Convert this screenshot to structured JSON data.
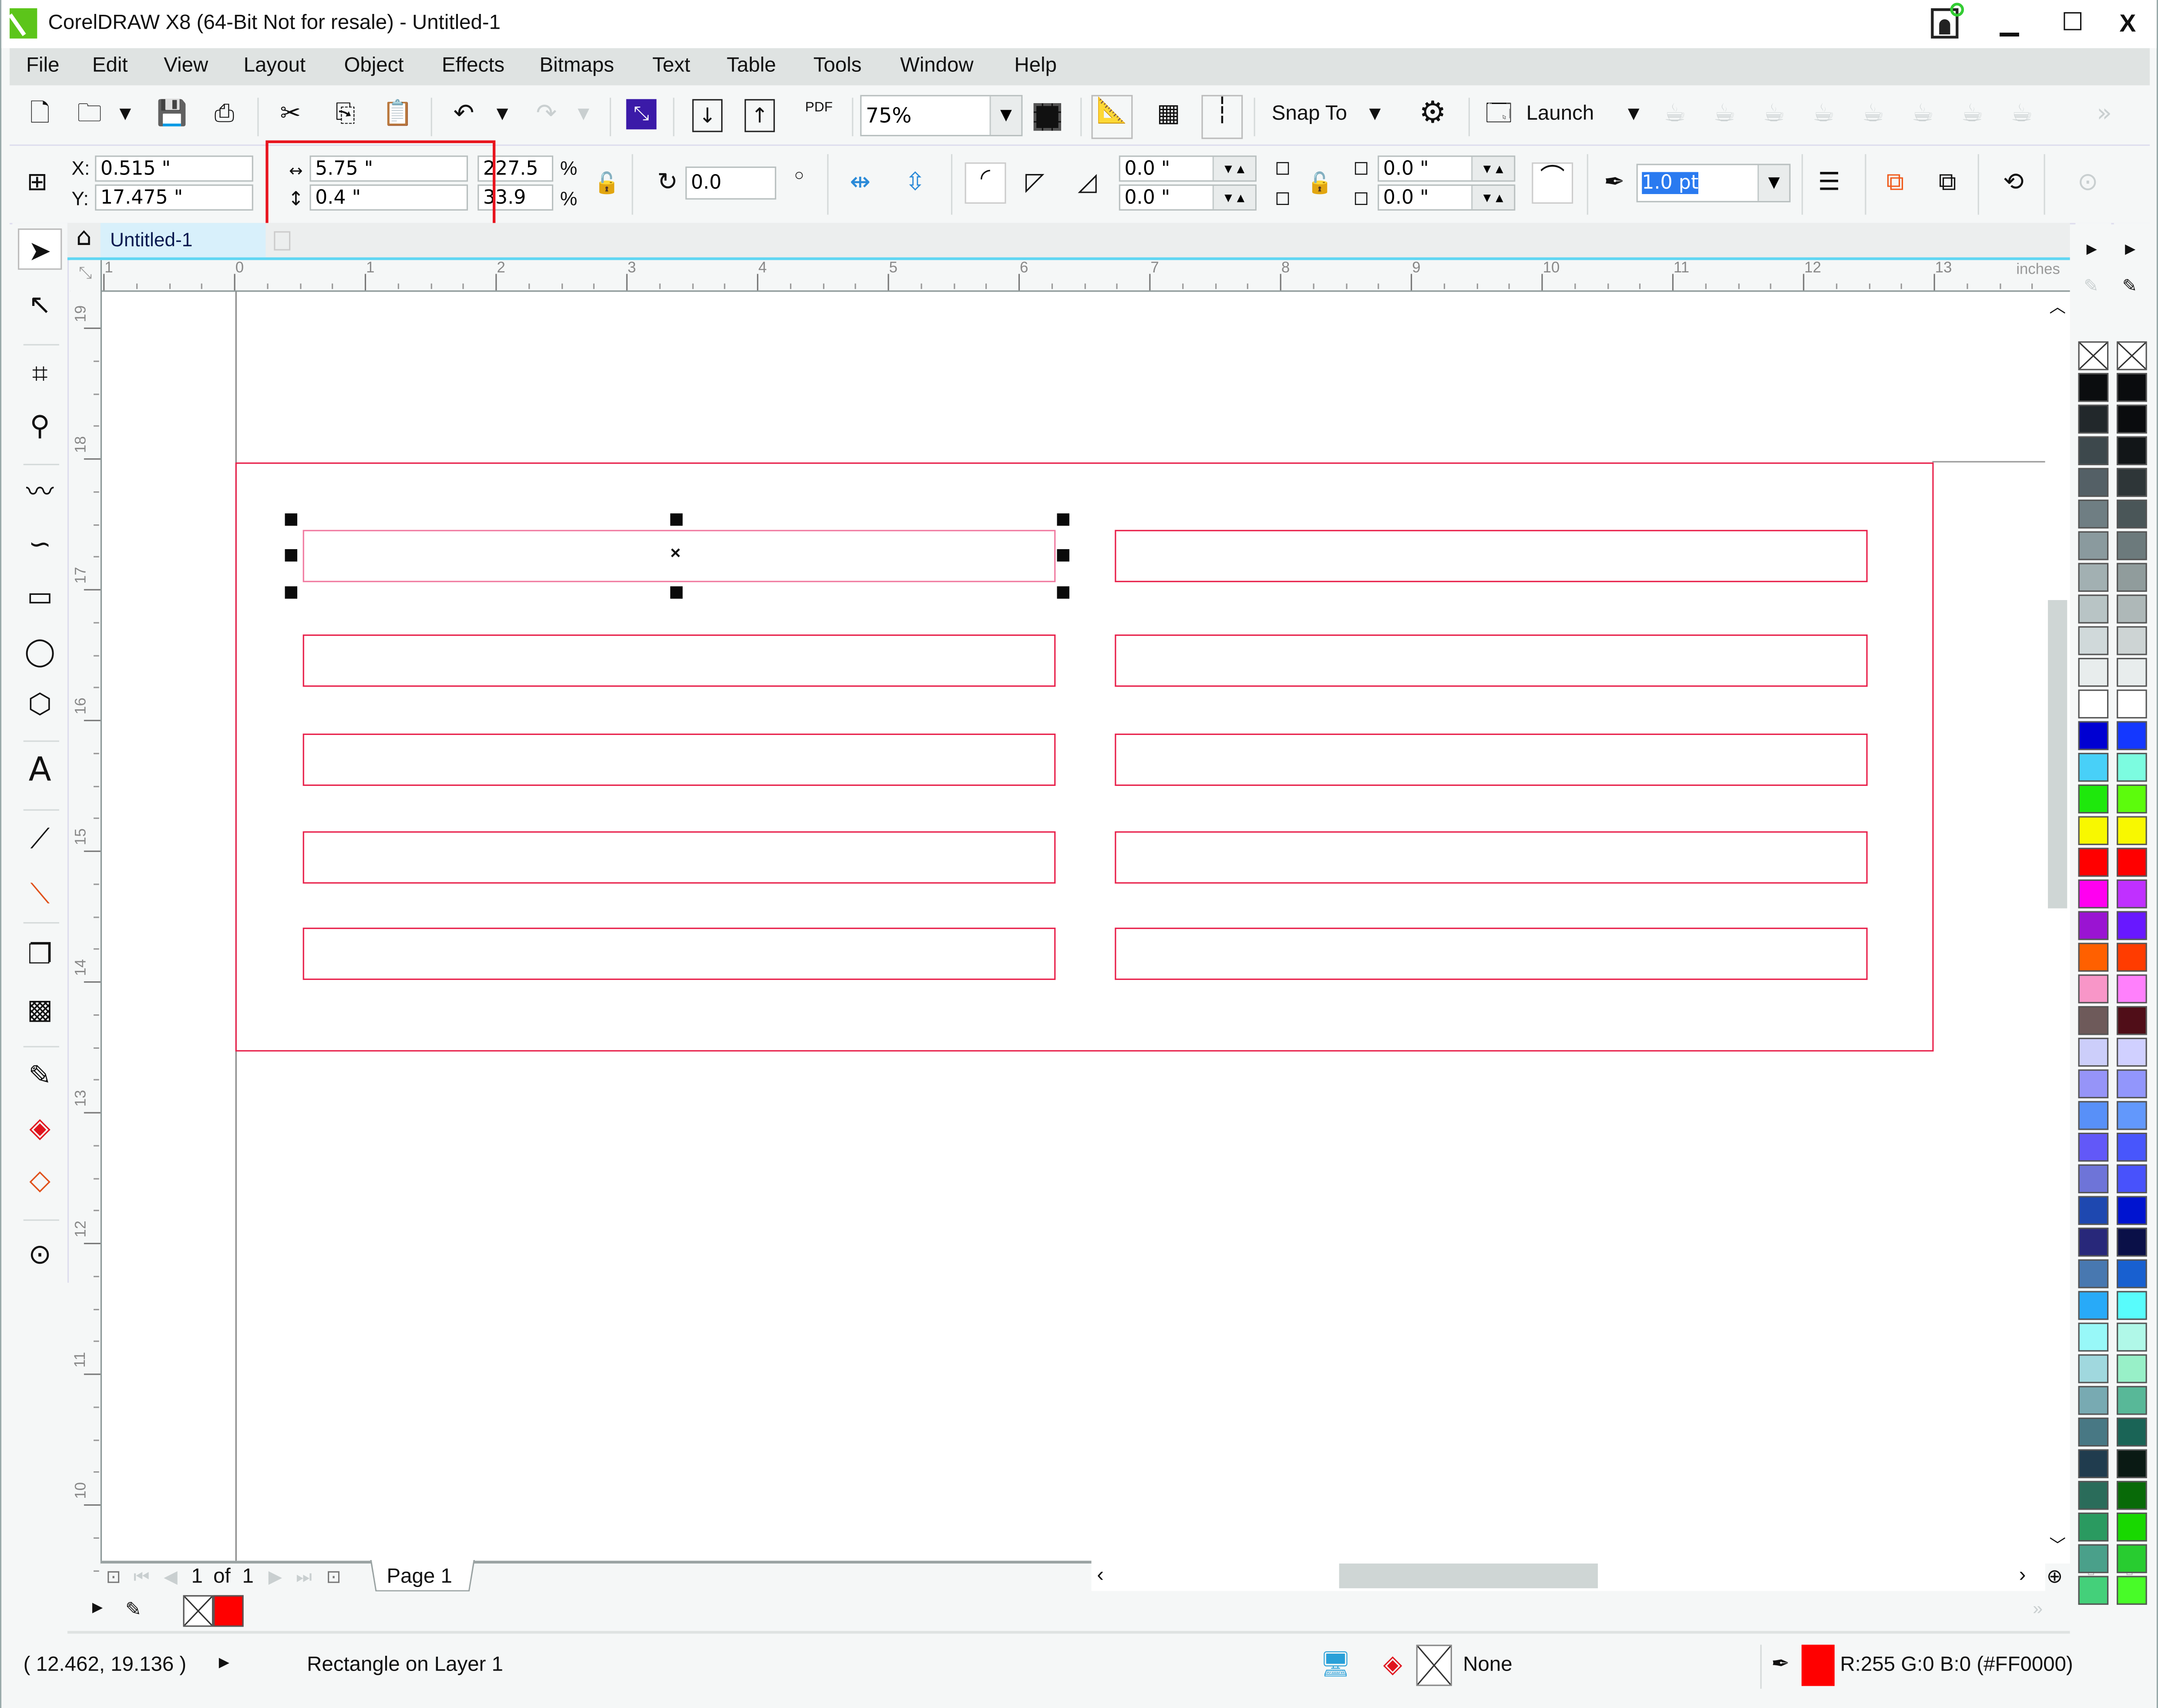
{
  "window": {
    "title": "CorelDRAW X8 (64-Bit Not for resale) - Untitled-1",
    "controls": {
      "minimize": "▁",
      "maximize": "☐",
      "close": "X"
    }
  },
  "menu": [
    "File",
    "Edit",
    "View",
    "Layout",
    "Object",
    "Effects",
    "Bitmaps",
    "Text",
    "Table",
    "Tools",
    "Window",
    "Help"
  ],
  "standard_toolbar": {
    "zoom_level": "75%",
    "snap_to_label": "Snap To",
    "launch_label": "Launch",
    "pdf_label": "PDF",
    "overflow": "»"
  },
  "property_bar": {
    "x_label": "X:",
    "y_label": "Y:",
    "x_value": "0.515 \"",
    "y_value": "17.475 \"",
    "width_value": "5.75 \"",
    "height_value": "0.4 \"",
    "scale_w": "227.5",
    "scale_h": "33.9",
    "percent": "%",
    "rotation": "0.0",
    "degree": "○",
    "corner_tl": "0.0 \"",
    "corner_bl": "0.0 \"",
    "corner_tr": "0.0 \"",
    "corner_br": "0.0 \"",
    "outline_width": "1.0 pt",
    "highlight_color": "#e8141e"
  },
  "document_tab": {
    "label": "Untitled-1"
  },
  "rulers": {
    "horizontal_labels": [
      "1",
      "0",
      "1",
      "2",
      "3",
      "4",
      "5",
      "6",
      "7",
      "8",
      "9",
      "10",
      "11",
      "12",
      "13"
    ],
    "unit": "inches",
    "vertical_labels": [
      "19",
      "18",
      "17",
      "16",
      "15",
      "14",
      "13",
      "12",
      "11",
      "10"
    ]
  },
  "canvas": {
    "outline_color": "#e8204a",
    "selected_object": "Rectangle",
    "object_rows": 5,
    "object_columns": 2
  },
  "page_nav": {
    "current": "1",
    "of_label": "of",
    "total": "1",
    "page_tab": "Page 1"
  },
  "palette_primary": [
    "none",
    "#0b0d0f",
    "#22282b",
    "#3d484c",
    "#546066",
    "#6f7e83",
    "#8a9a9e",
    "#a2b0b2",
    "#b8c4c5",
    "#d0d9da",
    "#e8eded",
    "#ffffff",
    "#0000d2",
    "#48d0f8",
    "#1ee80c",
    "#f8f800",
    "#ff0000",
    "#ff00f0",
    "#9a14d2",
    "#ff6000",
    "#f896c8",
    "#6e5a5a",
    "#cccefa",
    "#9694f8",
    "#5890f8",
    "#6258f8",
    "#6e74d8",
    "#1e48b0",
    "#28287a",
    "#4878b0",
    "#28aaf8",
    "#98f8f8",
    "#a0d8de",
    "#78aab2",
    "#487884",
    "#203c4e",
    "#2a6c5a",
    "#2a9a60",
    "#4aa08a",
    "#44d07a"
  ],
  "palette_secondary": [
    "none",
    "#0a0c0e",
    "#0a0c0e",
    "#121618",
    "#2e3638",
    "#4a5658",
    "#6c7a7c",
    "#909c9c",
    "#aeb8b8",
    "#cdd4d4",
    "#e8eded",
    "#ffffff",
    "#1438ff",
    "#7cfce0",
    "#5cfc0c",
    "#f8f800",
    "#ff0000",
    "#c030ff",
    "#6818ff",
    "#ff3c00",
    "#ff80fc",
    "#500e18",
    "#d0d0ff",
    "#9296fc",
    "#6298fc",
    "#4856fc",
    "#4852fc",
    "#0014d0",
    "#0a1048",
    "#1860d0",
    "#58fcfc",
    "#b0f8e8",
    "#98f0c8",
    "#58b898",
    "#1a6456",
    "#0a1a14",
    "#086a08",
    "#18d800",
    "#28cc30",
    "#48fc28"
  ],
  "document_palette": {
    "none_swatch": "none",
    "swatch": "#ff0000"
  },
  "status_bar": {
    "cursor_position": "( 12.462, 19.136 )",
    "object_info": "Rectangle on Layer 1",
    "fill_label": "None",
    "outline_color_text": "R:255 G:0 B:0 (#FF0000)",
    "outline_color": "#ff0000"
  }
}
